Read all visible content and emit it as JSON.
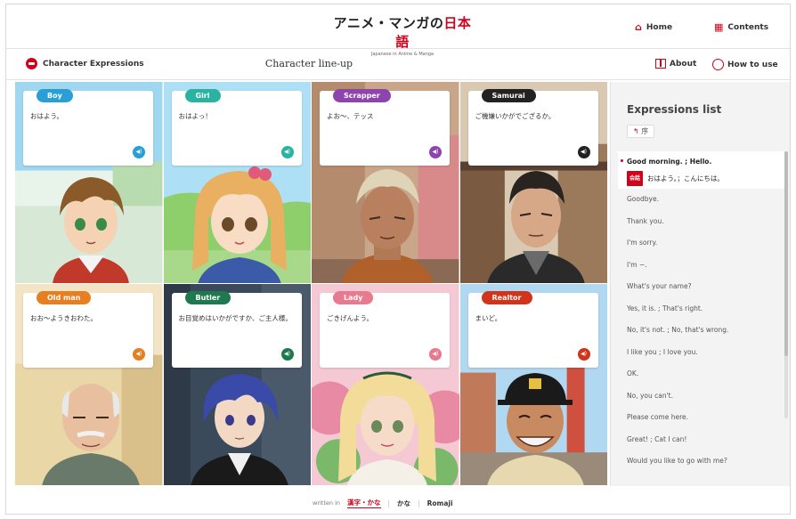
{
  "header": {
    "logo_main_a": "アニメ・マンガの",
    "logo_main_b": "日本語",
    "logo_sub": "Japanese in Anime & Manga",
    "home_label": "Home",
    "contents_label": "Contents"
  },
  "subheader": {
    "section_label": "Character Expressions",
    "page_title": "Character line-up",
    "about_label": "About",
    "howto_label": "How to use"
  },
  "characters": [
    {
      "name": "Boy",
      "phrase": "おはよう。",
      "color": "#2a9fd6"
    },
    {
      "name": "Girl",
      "phrase": "おはよっ！",
      "color": "#2bb3a1"
    },
    {
      "name": "Scrapper",
      "phrase": "よお～、テッス",
      "color": "#8e44ad"
    },
    {
      "name": "Samurai",
      "phrase": "ご機嫌いかがでござるか。",
      "color": "#222222"
    },
    {
      "name": "Old man",
      "phrase": "おお～ようきおわた。",
      "color": "#e67e22"
    },
    {
      "name": "Butler",
      "phrase": "お目覚めはいかがですか、ご主人様。",
      "color": "#1e7a4e"
    },
    {
      "name": "Lady",
      "phrase": "ごきげんよう。",
      "color": "#e87a90"
    },
    {
      "name": "Realtor",
      "phrase": "まいど。",
      "color": "#d0341b"
    }
  ],
  "panel": {
    "title": "Expressions list",
    "chip_mark": "↰",
    "chip_label": "序",
    "active_item": "Good morning. ; Hello.",
    "active_tag": "会話",
    "active_sub": "おはよう。；こんにちは。",
    "items": [
      "Goodbye.",
      "Thank you.",
      "I'm sorry.",
      "I'm ~.",
      "What's your name?",
      "Yes, it is. ; That's right.",
      "No, it's not. ; No, that's wrong.",
      "I like you ; I love you.",
      "OK.",
      "No, you can't.",
      "Please come here.",
      "Great! ; Cat I can!",
      "Would you like to go with me?"
    ]
  },
  "footer": {
    "label": "written in",
    "opt1": "漢字・かな",
    "opt2": "かな",
    "opt3": "Romaji"
  }
}
